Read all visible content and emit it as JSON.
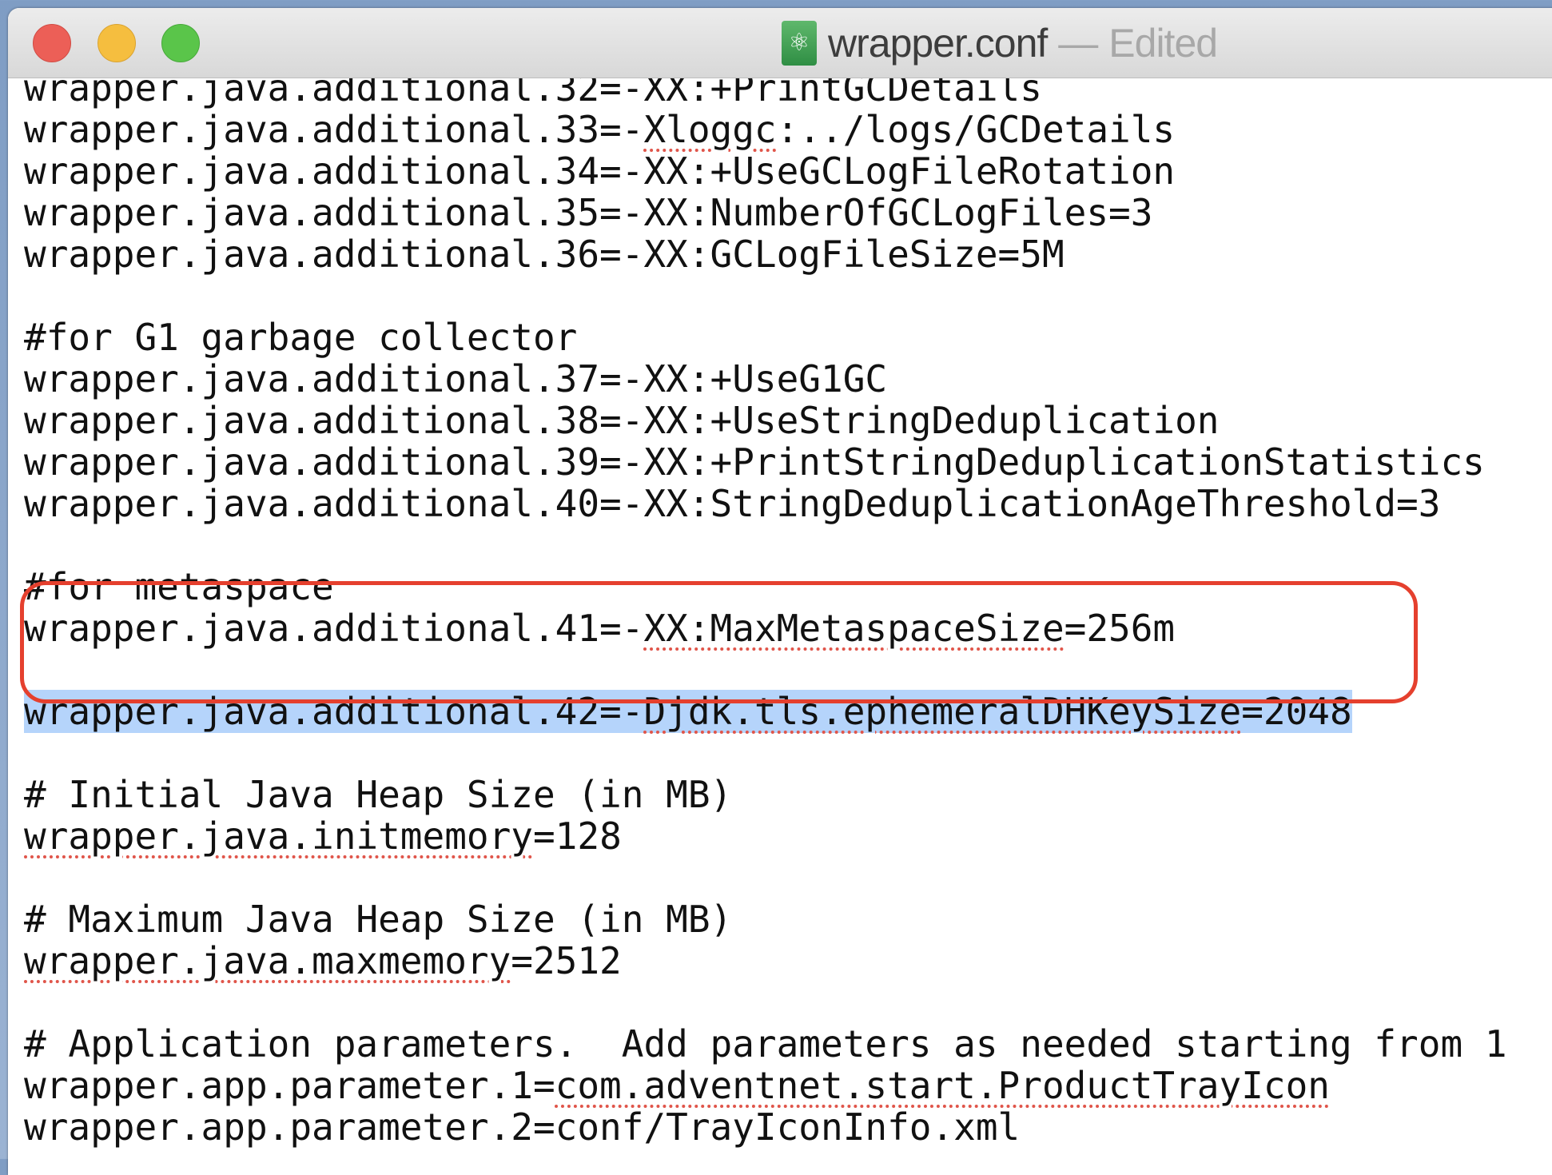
{
  "window": {
    "title": "wrapper.conf",
    "title_separator": "—",
    "status": "Edited",
    "icon": "text-document-atom-icon"
  },
  "editor": {
    "lines": [
      [
        {
          "t": "wrapper.java.additional.32=-XX:+PrintGCDetails"
        }
      ],
      [
        {
          "t": "wrapper.java.additional.33=-"
        },
        {
          "t": "Xloggc",
          "m": true
        },
        {
          "t": ":../logs/GCDetails"
        }
      ],
      [
        {
          "t": "wrapper.java.additional.34=-XX:+UseGCLogFileRotation"
        }
      ],
      [
        {
          "t": "wrapper.java.additional.35=-XX:NumberOfGCLogFiles=3"
        }
      ],
      [
        {
          "t": "wrapper.java.additional.36=-XX:GCLogFileSize=5M"
        }
      ],
      [],
      [
        {
          "t": "#for G1 garbage collector"
        }
      ],
      [
        {
          "t": "wrapper.java.additional.37=-XX:+UseG1GC"
        }
      ],
      [
        {
          "t": "wrapper.java.additional.38=-XX:+UseStringDeduplication"
        }
      ],
      [
        {
          "t": "wrapper.java.additional.39=-XX:+PrintStringDeduplicationStatistics"
        }
      ],
      [
        {
          "t": "wrapper.java.additional.40=-XX:StringDeduplicationAgeThreshold=3"
        }
      ],
      [],
      [
        {
          "t": "#for metaspace"
        }
      ],
      [
        {
          "t": "wrapper.java.additional.41=-"
        },
        {
          "t": "XX:MaxMetaspaceSize",
          "m": true
        },
        {
          "t": "=256m"
        }
      ],
      [],
      [
        {
          "t": "wrapper.java.additional.42=-"
        },
        {
          "t": "Djdk.tls.ephemeralDHKeySize",
          "m": true
        },
        {
          "t": "=2048"
        }
      ],
      [],
      [
        {
          "t": "# Initial Java Heap Size (in MB)"
        }
      ],
      [
        {
          "t": "wrapper.java.initmemory",
          "m": true
        },
        {
          "t": "=128"
        }
      ],
      [],
      [
        {
          "t": "# Maximum Java Heap Size (in MB)"
        }
      ],
      [
        {
          "t": "wrapper.java.maxmemory",
          "m": true
        },
        {
          "t": "=2512"
        }
      ],
      [],
      [
        {
          "t": "# Application parameters.  Add parameters as needed starting from 1"
        }
      ],
      [
        {
          "t": "wrapper.app.parameter.1="
        },
        {
          "t": "com.adventnet.start.ProductTrayIcon",
          "m": true
        }
      ],
      [
        {
          "t": "wrapper.app.parameter.2=conf/TrayIconInfo.xml"
        }
      ]
    ],
    "selected_line": 15
  },
  "colors": {
    "selection": "#b5d4fb",
    "callout_border": "#e5402e",
    "spellcheck": "#e0554a"
  }
}
